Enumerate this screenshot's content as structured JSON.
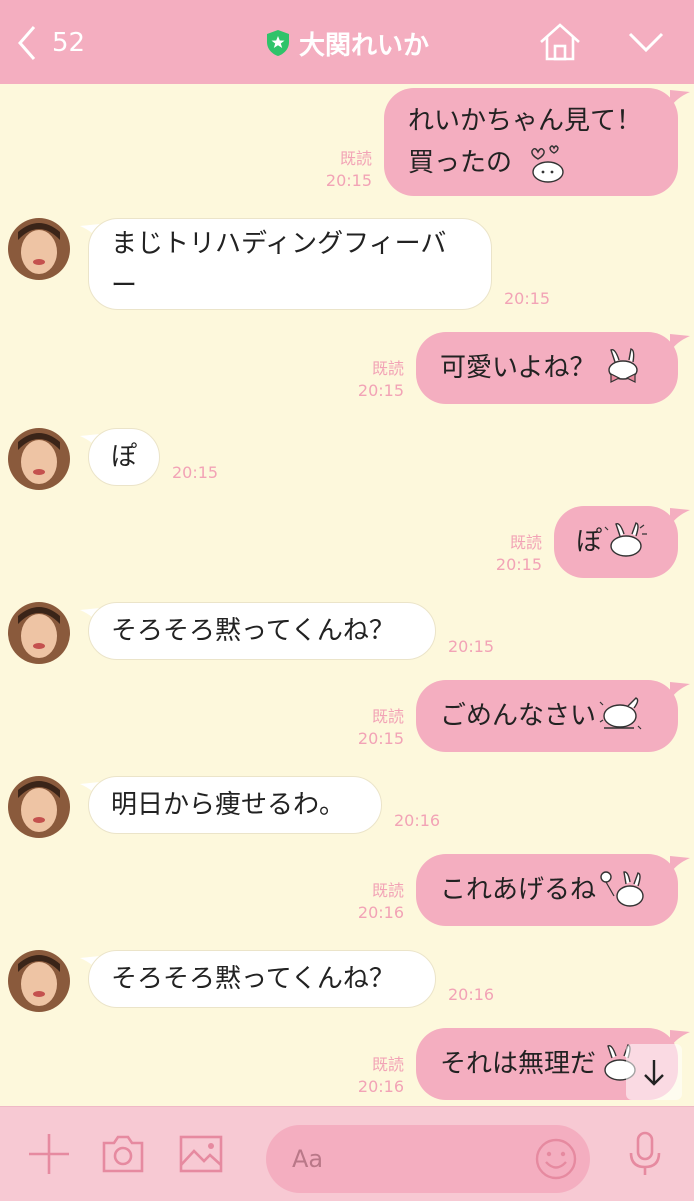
{
  "header": {
    "back_count": "52",
    "title": "大関れいか"
  },
  "messages": [
    {
      "side": "out",
      "lines": [
        "れいかちゃん見て！",
        "買ったの"
      ],
      "read": "既読",
      "time": "20:15",
      "sticker": "bunny-hearts-icon"
    },
    {
      "side": "in",
      "lines": [
        "まじトリハディングフィーバ",
        "ー"
      ],
      "time": "20:15"
    },
    {
      "side": "out",
      "lines": [
        "可愛いよね？"
      ],
      "read": "既読",
      "time": "20:15",
      "sticker": "bunny-bow-icon"
    },
    {
      "side": "in",
      "lines": [
        "ぽ"
      ],
      "time": "20:15"
    },
    {
      "side": "out",
      "lines": [
        "ぽ"
      ],
      "read": "既読",
      "time": "20:15",
      "sticker": "bunny-excited-icon"
    },
    {
      "side": "in",
      "lines": [
        "そろそろ黙ってくんね？"
      ],
      "time": "20:15"
    },
    {
      "side": "out",
      "lines": [
        "ごめんなさい"
      ],
      "read": "既読",
      "time": "20:15",
      "sticker": "bunny-bow-down-icon"
    },
    {
      "side": "in",
      "lines": [
        "明日から痩せるわ。"
      ],
      "time": "20:16"
    },
    {
      "side": "out",
      "lines": [
        "これあげるね"
      ],
      "read": "既読",
      "time": "20:16",
      "sticker": "bunny-balloon-icon"
    },
    {
      "side": "in",
      "lines": [
        "そろそろ黙ってくんね？"
      ],
      "time": "20:16"
    },
    {
      "side": "out",
      "lines": [
        "それは無理だ"
      ],
      "read": "既読",
      "time": "20:16",
      "sticker": "bunny-icon"
    }
  ],
  "input": {
    "placeholder": "Aa"
  },
  "colors": {
    "header": "#f4aec0",
    "background": "#fdf8dc",
    "out_bubble": "#f4aec0",
    "in_bubble": "#ffffff",
    "meta": "#f2a3b6"
  }
}
